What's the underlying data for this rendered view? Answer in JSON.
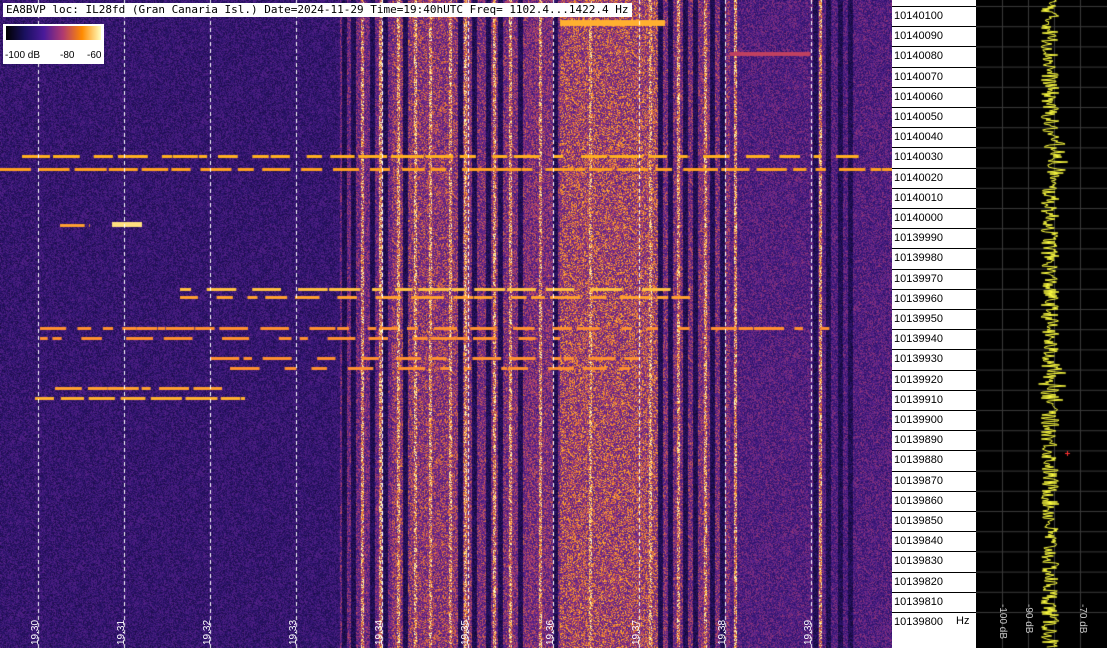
{
  "header": {
    "text": "EA8BVP loc: IL28fd (Gran Canaria Isl.) Date=2024-11-29 Time=19:40hUTC Freq= 1102.4...1422.4 Hz"
  },
  "legend": {
    "labels": [
      "-100 dB",
      "-80",
      "-60"
    ]
  },
  "time_axis": {
    "labels": [
      "19.30",
      "19.31",
      "19.32",
      "19.33",
      "19.34",
      "19.35",
      "19.36",
      "19.37",
      "19.38",
      "19.39"
    ]
  },
  "frequency_axis": {
    "labels": [
      "10140100",
      "10140090",
      "10140080",
      "10140070",
      "10140060",
      "10140050",
      "10140040",
      "10140030",
      "10140020",
      "10140010",
      "10140000",
      "10139990",
      "10139980",
      "10139970",
      "10139960",
      "10139950",
      "10139940",
      "10139930",
      "10139920",
      "10139910",
      "10139900",
      "10139890",
      "10139880",
      "10139870",
      "10139860",
      "10139850",
      "10139840",
      "10139830",
      "10139820",
      "10139810",
      "10139800"
    ],
    "unit": "Hz"
  },
  "spectrum": {
    "db_labels": [
      "-100 dB",
      "-90 dB",
      "-70 dB"
    ]
  },
  "colors": {
    "background_low": "#3a1670",
    "signal": "#ffb020",
    "spectrum_trace": "#ffff40"
  }
}
